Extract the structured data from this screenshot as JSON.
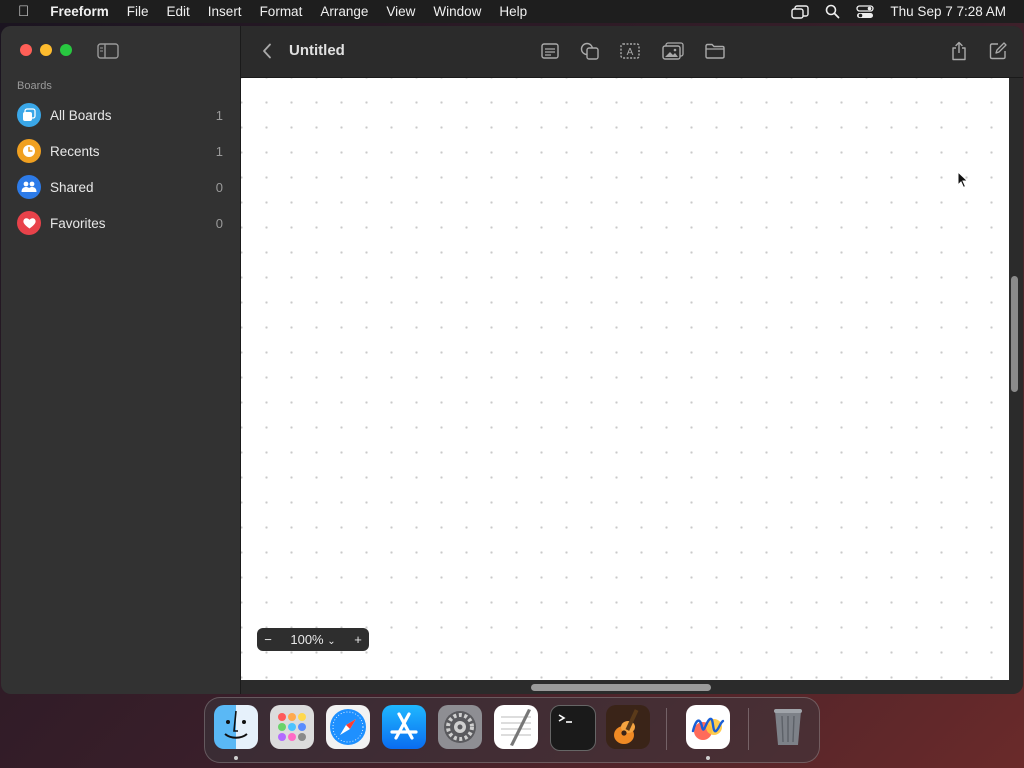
{
  "menubar": {
    "app_name": "Freeform",
    "menus": [
      "File",
      "Edit",
      "Insert",
      "Format",
      "Arrange",
      "View",
      "Window",
      "Help"
    ],
    "clock": "Thu Sep 7  7:28 AM"
  },
  "sidebar": {
    "heading": "Boards",
    "items": [
      {
        "label": "All Boards",
        "count": "1",
        "icon": "boards-icon",
        "color": "#3aa7e8"
      },
      {
        "label": "Recents",
        "count": "1",
        "icon": "clock-icon",
        "color": "#f0a020"
      },
      {
        "label": "Shared",
        "count": "0",
        "icon": "people-icon",
        "color": "#2d7be8"
      },
      {
        "label": "Favorites",
        "count": "0",
        "icon": "heart-icon",
        "color": "#e8424a"
      }
    ]
  },
  "toolbar": {
    "title": "Untitled"
  },
  "zoom": {
    "value": "100%"
  },
  "dock": {
    "apps": [
      "Finder",
      "Launchpad",
      "Safari",
      "App Store",
      "System Settings",
      "TextEdit",
      "Terminal",
      "GarageBand",
      "Freeform",
      "Trash"
    ]
  }
}
